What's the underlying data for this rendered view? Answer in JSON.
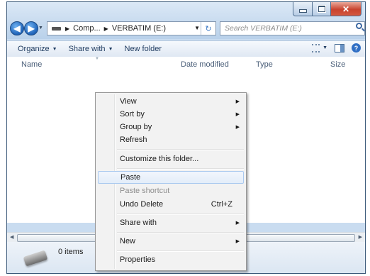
{
  "window": {
    "caption_buttons": {
      "minimize_icon": "minimize-icon",
      "maximize_icon": "maximize-icon",
      "close_icon": "close-icon"
    }
  },
  "address": {
    "crumbs": [
      "Comp...",
      "VERBATIM (E:)"
    ],
    "search_placeholder": "Search VERBATIM (E:)"
  },
  "toolbar": {
    "organize": "Organize",
    "share_with": "Share with",
    "new_folder": "New folder"
  },
  "columns": {
    "name": "Name",
    "date_modified": "Date modified",
    "type": "Type",
    "size": "Size"
  },
  "details": {
    "item_count": "0 items"
  },
  "context_menu": {
    "view": "View",
    "sort_by": "Sort by",
    "group_by": "Group by",
    "refresh": "Refresh",
    "customize": "Customize this folder...",
    "paste": "Paste",
    "paste_shortcut": "Paste shortcut",
    "undo_delete": "Undo Delete",
    "undo_shortcut": "Ctrl+Z",
    "share_with": "Share with",
    "new": "New",
    "properties": "Properties"
  },
  "colors": {
    "frame": "#c9dcf0",
    "close_button": "#c8432e",
    "highlight": "#aac9ef"
  }
}
